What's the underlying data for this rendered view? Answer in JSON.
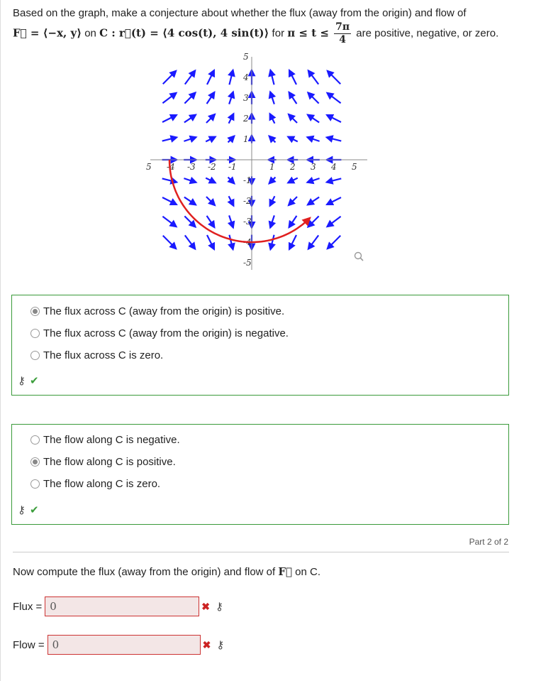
{
  "question": {
    "prefix": "Based on the graph, make a conjecture about whether the flux (away from the origin) and flow of",
    "field_text": "F⃗ = ⟨−x, y⟩",
    "on_text": " on ",
    "curve_text": "C : r⃗(t) = ⟨4 cos(t), 4 sin(t)⟩",
    "for_text": " for ",
    "range_text": "π ≤ t ≤",
    "frac_num": "7π",
    "frac_den": "4",
    "suffix": "are positive, negative, or zero."
  },
  "graph": {
    "x_ticks": [
      "5",
      "-4",
      "-3",
      "-2",
      "-1",
      "1",
      "2",
      "3",
      "4",
      "5"
    ],
    "y_ticks": [
      "5",
      "4",
      "3",
      "2",
      "1",
      "-1",
      "-2",
      "-3",
      "-4",
      "-5"
    ],
    "arrow_color": "#1a1aff",
    "curve_color": "#e02020",
    "zoom_icon": "magnifier-icon"
  },
  "flux_box": {
    "options": [
      {
        "label": "The flux across C (away from the origin) is positive.",
        "selected": true
      },
      {
        "label": "The flux across C (away from the origin) is negative.",
        "selected": false
      },
      {
        "label": "The flux across C is zero.",
        "selected": false
      }
    ],
    "key_icon": "⚷",
    "check": "✔"
  },
  "flow_box": {
    "options": [
      {
        "label": "The flow along C is negative.",
        "selected": false
      },
      {
        "label": "The flow along C is positive.",
        "selected": true
      },
      {
        "label": "The flow along C is zero.",
        "selected": false
      }
    ],
    "key_icon": "⚷",
    "check": "✔"
  },
  "part_label": "Part 2 of 2",
  "part2": {
    "prompt_prefix": "Now compute the flux (away from the origin) and flow of ",
    "prompt_field": "F⃗",
    "prompt_suffix": " on C.",
    "flux_label": "Flux =",
    "flux_value": "0",
    "flow_label": "Flow =",
    "flow_value": "0",
    "wrong_mark": "✖",
    "key_icon": "⚷"
  }
}
